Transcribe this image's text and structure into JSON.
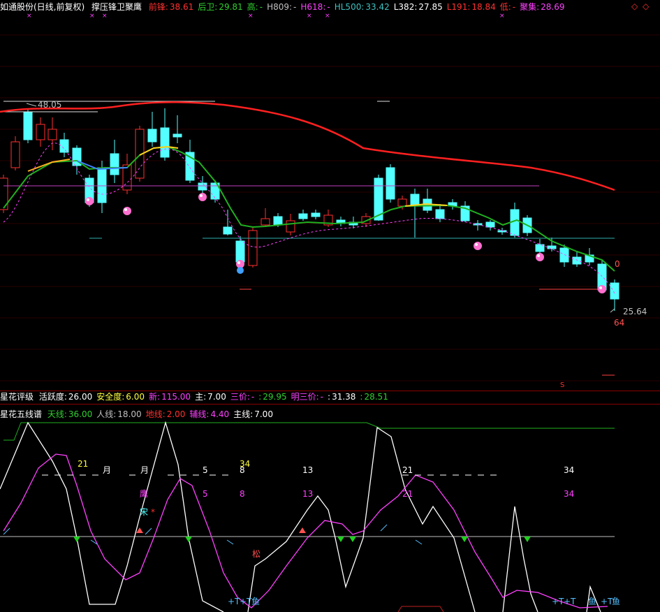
{
  "header": {
    "title": "如通股份(日线,前复权)",
    "indicator": "撑压锋卫聚鹰",
    "items": [
      {
        "label": "前锋:",
        "value": "38.61",
        "color": "#ff3030"
      },
      {
        "label": "后卫:",
        "value": "29.81",
        "color": "#30d030"
      },
      {
        "label": "高:",
        "value": "-",
        "color": "#30d030"
      },
      {
        "label": "H809:",
        "value": "-",
        "color": "#c0c0c0"
      },
      {
        "label": "H618:",
        "value": "-",
        "color": "#ff40ff"
      },
      {
        "label": "HL500:",
        "value": "33.42",
        "color": "#40c0c0"
      },
      {
        "label": "L382:",
        "value": "27.85",
        "color": "#ffffff"
      },
      {
        "label": "L191:",
        "value": "18.84",
        "color": "#ff3030"
      },
      {
        "label": "低:",
        "value": "-",
        "color": "#ff3030"
      },
      {
        "label": "聚集:",
        "value": "28.69",
        "color": "#ff40ff"
      }
    ],
    "window_controls": [
      "◇",
      "◇"
    ]
  },
  "price_chart": {
    "high_label": "48.05",
    "low_label": "25.64",
    "right_top_number": "0",
    "right_bottom_number": "64",
    "s_marker": "S"
  },
  "rating_panel": {
    "title": "星花评级",
    "items": [
      {
        "label": "活跃度:",
        "value": "26.00",
        "color": "#ffffff"
      },
      {
        "label": "安全度:",
        "value": "6.00",
        "color": "#ffff40"
      },
      {
        "label": "新:",
        "value": "115.00",
        "color": "#ff40ff"
      },
      {
        "label": "主:",
        "value": "7.00",
        "color": "#ffffff"
      },
      {
        "label": "三价:",
        "value": "-",
        "color": "#ff40ff"
      },
      {
        "label": ":",
        "value": "29.95",
        "color": "#30d030"
      },
      {
        "label": "明三价:",
        "value": "-",
        "color": "#ff40ff"
      },
      {
        "label": ":",
        "value": "31.38",
        "color": "#ffffff"
      },
      {
        "label": ":",
        "value": "28.51",
        "color": "#30d030"
      }
    ]
  },
  "five_lines_panel": {
    "title": "星花五线谱",
    "items": [
      {
        "label": "天线:",
        "value": "36.00",
        "color": "#30d030"
      },
      {
        "label": "人线:",
        "value": "18.00",
        "color": "#c0c0c0"
      },
      {
        "label": "地线:",
        "value": "2.00",
        "color": "#ff3030"
      },
      {
        "label": "辅线:",
        "value": "4.40",
        "color": "#ff40ff"
      },
      {
        "label": "主线:",
        "value": "7.00",
        "color": "#ffffff"
      }
    ],
    "labels": {
      "n21a": "21",
      "yue1": "月",
      "yue2": "月",
      "n5a": "5",
      "n34a": "34",
      "n8a": "8",
      "n13a": "13",
      "n21b": "21",
      "n34b": "34",
      "ying": "鹰",
      "n5b": "5",
      "n8b": "8",
      "n13b": "13",
      "n21c": "21",
      "n34c": "34",
      "song": "宋",
      "star": "*",
      "song2": "松",
      "t1": "+T",
      "t2": "+T",
      "yu1": "鱼",
      "t3": "+T",
      "t4": "+T",
      "yu2": "鱼",
      "t5": "+T",
      "yu3": "鱼"
    }
  },
  "colors": {
    "up": "#ff3030",
    "down": "#54ffff",
    "ma_green": "#20b020",
    "ma_red": "#ff2020",
    "magenta": "#ff40ff"
  }
}
